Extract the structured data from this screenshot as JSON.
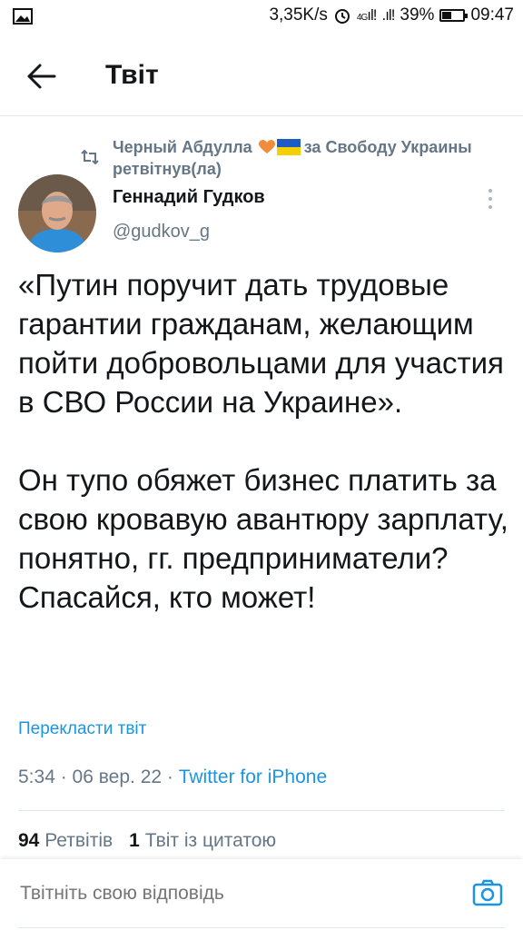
{
  "status_bar": {
    "network_speed": "3,35K/s",
    "network_type": "4G",
    "battery": "39%",
    "battery_level": 0.39,
    "time": "09:47"
  },
  "header": {
    "title": "Твіт",
    "back_icon": "arrow-left-icon"
  },
  "retweet": {
    "name": "Черный Абдулла",
    "suffix": "за Свободу Украины",
    "action": "ретвітнув(ла)"
  },
  "author": {
    "name": "Геннадий Гудков",
    "handle": "@gudkov_g"
  },
  "tweet": {
    "text": "«Путин поручит дать трудовые гарантии гражданам, желающим пойти добровольцами для участия в СВО России на Украине».\n\nОн тупо обяжет бизнес платить за свою кровавую авантюру зарплату, понятно, гг. предприниматели? Спасайся, кто может!",
    "translate": "Перекласти твіт",
    "time": "5:34",
    "date": "06 вер. 22",
    "source": "Twitter for iPhone"
  },
  "stats": {
    "retweets_count": "94",
    "retweets_label": "Ретвітів",
    "quotes_count": "1",
    "quotes_label": "Твіт із цитатою"
  },
  "reply": {
    "placeholder": "Твітніть свою відповідь"
  },
  "colors": {
    "accent": "#1b95e0",
    "muted": "#657786",
    "text": "#14171a",
    "heart": "#f28b3a"
  }
}
